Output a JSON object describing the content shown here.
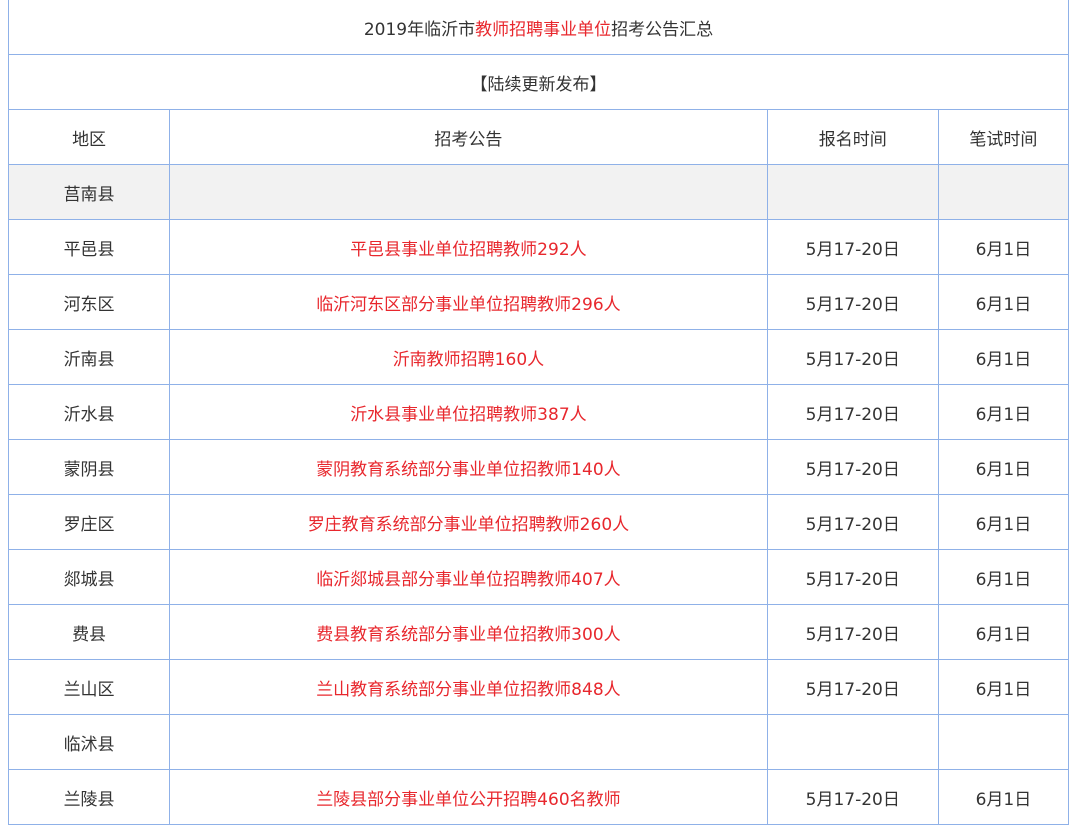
{
  "title": {
    "prefix": "2019年临沂市",
    "highlight": "教师招聘事业单位",
    "suffix": "招考公告汇总"
  },
  "subtitle": "【陆续更新发布】",
  "headers": [
    "地区",
    "招考公告",
    "报名时间",
    "笔试时间"
  ],
  "rows": [
    {
      "region": "莒南县",
      "notice": "",
      "reg": "",
      "exam": ""
    },
    {
      "region": "平邑县",
      "notice": "平邑县事业单位招聘教师292人",
      "reg": "5月17-20日",
      "exam": "6月1日"
    },
    {
      "region": "河东区",
      "notice": "临沂河东区部分事业单位招聘教师296人",
      "reg": "5月17-20日",
      "exam": "6月1日"
    },
    {
      "region": "沂南县",
      "notice": "沂南教师招聘160人",
      "reg": "5月17-20日",
      "exam": "6月1日"
    },
    {
      "region": "沂水县",
      "notice": "沂水县事业单位招聘教师387人",
      "reg": "5月17-20日",
      "exam": "6月1日"
    },
    {
      "region": "蒙阴县",
      "notice": "蒙阴教育系统部分事业单位招教师140人",
      "reg": "5月17-20日",
      "exam": "6月1日"
    },
    {
      "region": "罗庄区",
      "notice": "罗庄教育系统部分事业单位招聘教师260人",
      "reg": "5月17-20日",
      "exam": "6月1日"
    },
    {
      "region": "郯城县",
      "notice": "临沂郯城县部分事业单位招聘教师407人",
      "reg": "5月17-20日",
      "exam": "6月1日"
    },
    {
      "region": "费县",
      "notice": "费县教育系统部分事业单位招教师300人",
      "reg": "5月17-20日",
      "exam": "6月1日"
    },
    {
      "region": "兰山区",
      "notice": "兰山教育系统部分事业单位招教师848人",
      "reg": "5月17-20日",
      "exam": "6月1日"
    },
    {
      "region": "临沭县",
      "notice": "",
      "reg": "",
      "exam": ""
    },
    {
      "region": "兰陵县",
      "notice": "兰陵县部分事业单位公开招聘460名教师",
      "reg": "5月17-20日",
      "exam": "6月1日"
    }
  ],
  "colors": {
    "border": "#8fb1e8",
    "link": "#e8272d",
    "text": "#333333",
    "shaded_row": "#f2f2f2"
  }
}
